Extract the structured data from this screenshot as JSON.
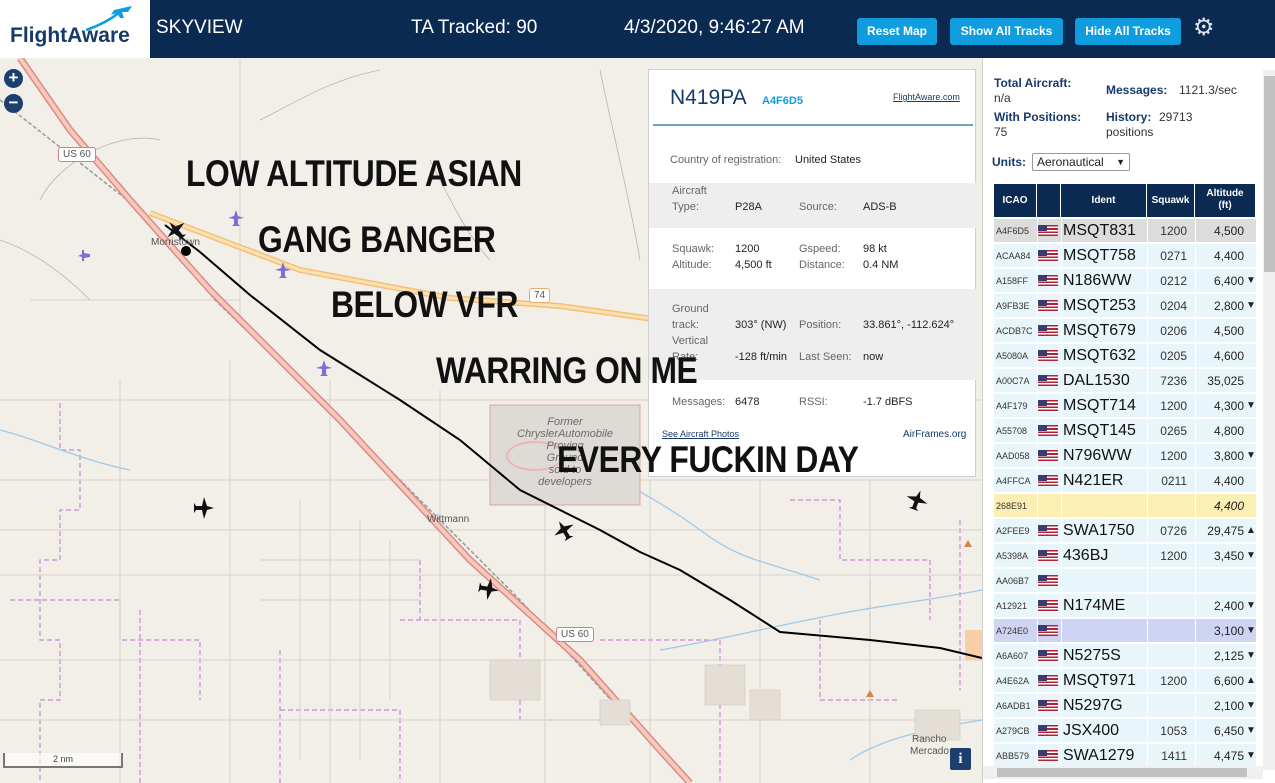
{
  "header": {
    "logo_text": "FlightAware",
    "app_name": "SKYVIEW",
    "tracked": "TA Tracked: 90",
    "datetime": "4/3/2020, 9:46:27 AM",
    "btn_reset": "Reset Map",
    "btn_show": "Show All Tracks",
    "btn_hide": "Hide All Tracks",
    "settings_icon": "gear-icon"
  },
  "map": {
    "places": {
      "morristown": "Morristown",
      "wittmann": "Wittmann",
      "rancho": "Rancho",
      "mercado": "Mercado",
      "chrysler_1": "Former",
      "chrysler_2": "ChryslerAutomobile",
      "chrysler_3": "Proving",
      "chrysler_4": "Ground",
      "chrysler_5": "sold to",
      "chrysler_6": "developers"
    },
    "roads": {
      "us60_a": "US 60",
      "us60_b": "US 60",
      "sr74": "74"
    },
    "overlay_lines": [
      "LOW ALTITUDE ASIAN",
      "GANG BANGER",
      "BELOW VFR",
      "WARRING ON ME",
      "EVERY FUCKIN DAY"
    ],
    "scale": "2 nm",
    "zoom_in": "+",
    "zoom_out": "−",
    "info": "i"
  },
  "detail": {
    "registration": "N419PA",
    "hex": "A4F6D5",
    "link_fa": "FlightAware.com",
    "country_label": "Country of registration:",
    "country": "United States",
    "aircraft_label_1": "Aircraft",
    "type_label": "Type:",
    "type": "P28A",
    "source_label": "Source:",
    "source": "ADS-B",
    "squawk_label": "Squawk:",
    "squawk": "1200",
    "gspeed_label": "Gspeed:",
    "gspeed": "98 kt",
    "altitude_label": "Altitude:",
    "altitude": "4,500 ft",
    "distance_label": "Distance:",
    "distance": "0.4 NM",
    "ground_label_1": "Ground",
    "ground_label_2": "track:",
    "ground_track": "303° (NW)",
    "position_label": "Position:",
    "position": "33.861°, -112.624°",
    "vert_label_1": "Vertical",
    "vert_label_2": "Rate:",
    "vert_rate": "-128 ft/min",
    "last_seen_label": "Last Seen:",
    "last_seen": "now",
    "messages_label": "Messages:",
    "messages": "6478",
    "rssi_label": "RSSI:",
    "rssi": "-1.7 dBFS",
    "link_photos": "See Aircraft Photos",
    "link_airframes": "AirFrames.org"
  },
  "stats": {
    "total_label": "Total Aircraft:",
    "total": "n/a",
    "messages_label": "Messages:",
    "messages": "1121.3/sec",
    "with_pos_label": "With Positions:",
    "with_pos": "75",
    "history_label": "History:",
    "history_1": "29713",
    "history_2": "positions",
    "units_label": "Units:",
    "units": "Aeronautical"
  },
  "table": {
    "headers": {
      "icao": "ICAO",
      "ident": "Ident",
      "squawk": "Squawk",
      "alt_1": "Altitude",
      "alt_2": "(ft)"
    },
    "rows": [
      {
        "icao": "A4F6D5",
        "ident": "MSQT831",
        "squawk": "1200",
        "alt": "4,500",
        "trend": "",
        "flag": true,
        "style": "sel"
      },
      {
        "icao": "ACAA84",
        "ident": "MSQT758",
        "squawk": "0271",
        "alt": "4,400",
        "trend": "",
        "flag": true,
        "style": ""
      },
      {
        "icao": "A158FF",
        "ident": "N186WW",
        "squawk": "0212",
        "alt": "6,400",
        "trend": "▼",
        "flag": true,
        "style": ""
      },
      {
        "icao": "A9FB3E",
        "ident": "MSQT253",
        "squawk": "0204",
        "alt": "2,800",
        "trend": "▼",
        "flag": true,
        "style": ""
      },
      {
        "icao": "ACDB7C",
        "ident": "MSQT679",
        "squawk": "0206",
        "alt": "4,500",
        "trend": "",
        "flag": true,
        "style": ""
      },
      {
        "icao": "A5080A",
        "ident": "MSQT632",
        "squawk": "0205",
        "alt": "4,600",
        "trend": "",
        "flag": true,
        "style": ""
      },
      {
        "icao": "A00C7A",
        "ident": "DAL1530",
        "squawk": "7236",
        "alt": "35,025",
        "trend": "",
        "flag": true,
        "style": ""
      },
      {
        "icao": "A4F179",
        "ident": "MSQT714",
        "squawk": "1200",
        "alt": "4,300",
        "trend": "▼",
        "flag": true,
        "style": ""
      },
      {
        "icao": "A55708",
        "ident": "MSQT145",
        "squawk": "0265",
        "alt": "4,800",
        "trend": "",
        "flag": true,
        "style": ""
      },
      {
        "icao": "AAD058",
        "ident": "N796WW",
        "squawk": "1200",
        "alt": "3,800",
        "trend": "▼",
        "flag": true,
        "style": ""
      },
      {
        "icao": "A4FFCA",
        "ident": "N421ER",
        "squawk": "0211",
        "alt": "4,400",
        "trend": "",
        "flag": true,
        "style": ""
      },
      {
        "icao": "268E91",
        "ident": "",
        "squawk": "",
        "alt": "4,400",
        "trend": "",
        "flag": false,
        "style": "yel"
      },
      {
        "icao": "A2FEE9",
        "ident": "SWA1750",
        "squawk": "0726",
        "alt": "29,475",
        "trend": "▲",
        "flag": true,
        "style": ""
      },
      {
        "icao": "A5398A",
        "ident": "436BJ",
        "squawk": "1200",
        "alt": "3,450",
        "trend": "▼",
        "flag": true,
        "style": ""
      },
      {
        "icao": "AA06B7",
        "ident": "",
        "squawk": "",
        "alt": "",
        "trend": "",
        "flag": true,
        "style": ""
      },
      {
        "icao": "A12921",
        "ident": "N174ME",
        "squawk": "",
        "alt": "2,400",
        "trend": "▼",
        "flag": true,
        "style": ""
      },
      {
        "icao": "A724E0",
        "ident": "",
        "squawk": "",
        "alt": "3,100",
        "trend": "▼",
        "flag": true,
        "style": "lav"
      },
      {
        "icao": "A6A607",
        "ident": "N5275S",
        "squawk": "",
        "alt": "2,125",
        "trend": "▼",
        "flag": true,
        "style": ""
      },
      {
        "icao": "A4E62A",
        "ident": "MSQT971",
        "squawk": "1200",
        "alt": "6,600",
        "trend": "▲",
        "flag": true,
        "style": ""
      },
      {
        "icao": "A6ADB1",
        "ident": "N5297G",
        "squawk": "",
        "alt": "2,100",
        "trend": "▼",
        "flag": true,
        "style": ""
      },
      {
        "icao": "A279CB",
        "ident": "JSX400",
        "squawk": "1053",
        "alt": "6,450",
        "trend": "▼",
        "flag": true,
        "style": ""
      },
      {
        "icao": "ABB579",
        "ident": "SWA1279",
        "squawk": "1411",
        "alt": "4,475",
        "trend": "▼",
        "flag": true,
        "style": ""
      }
    ]
  }
}
